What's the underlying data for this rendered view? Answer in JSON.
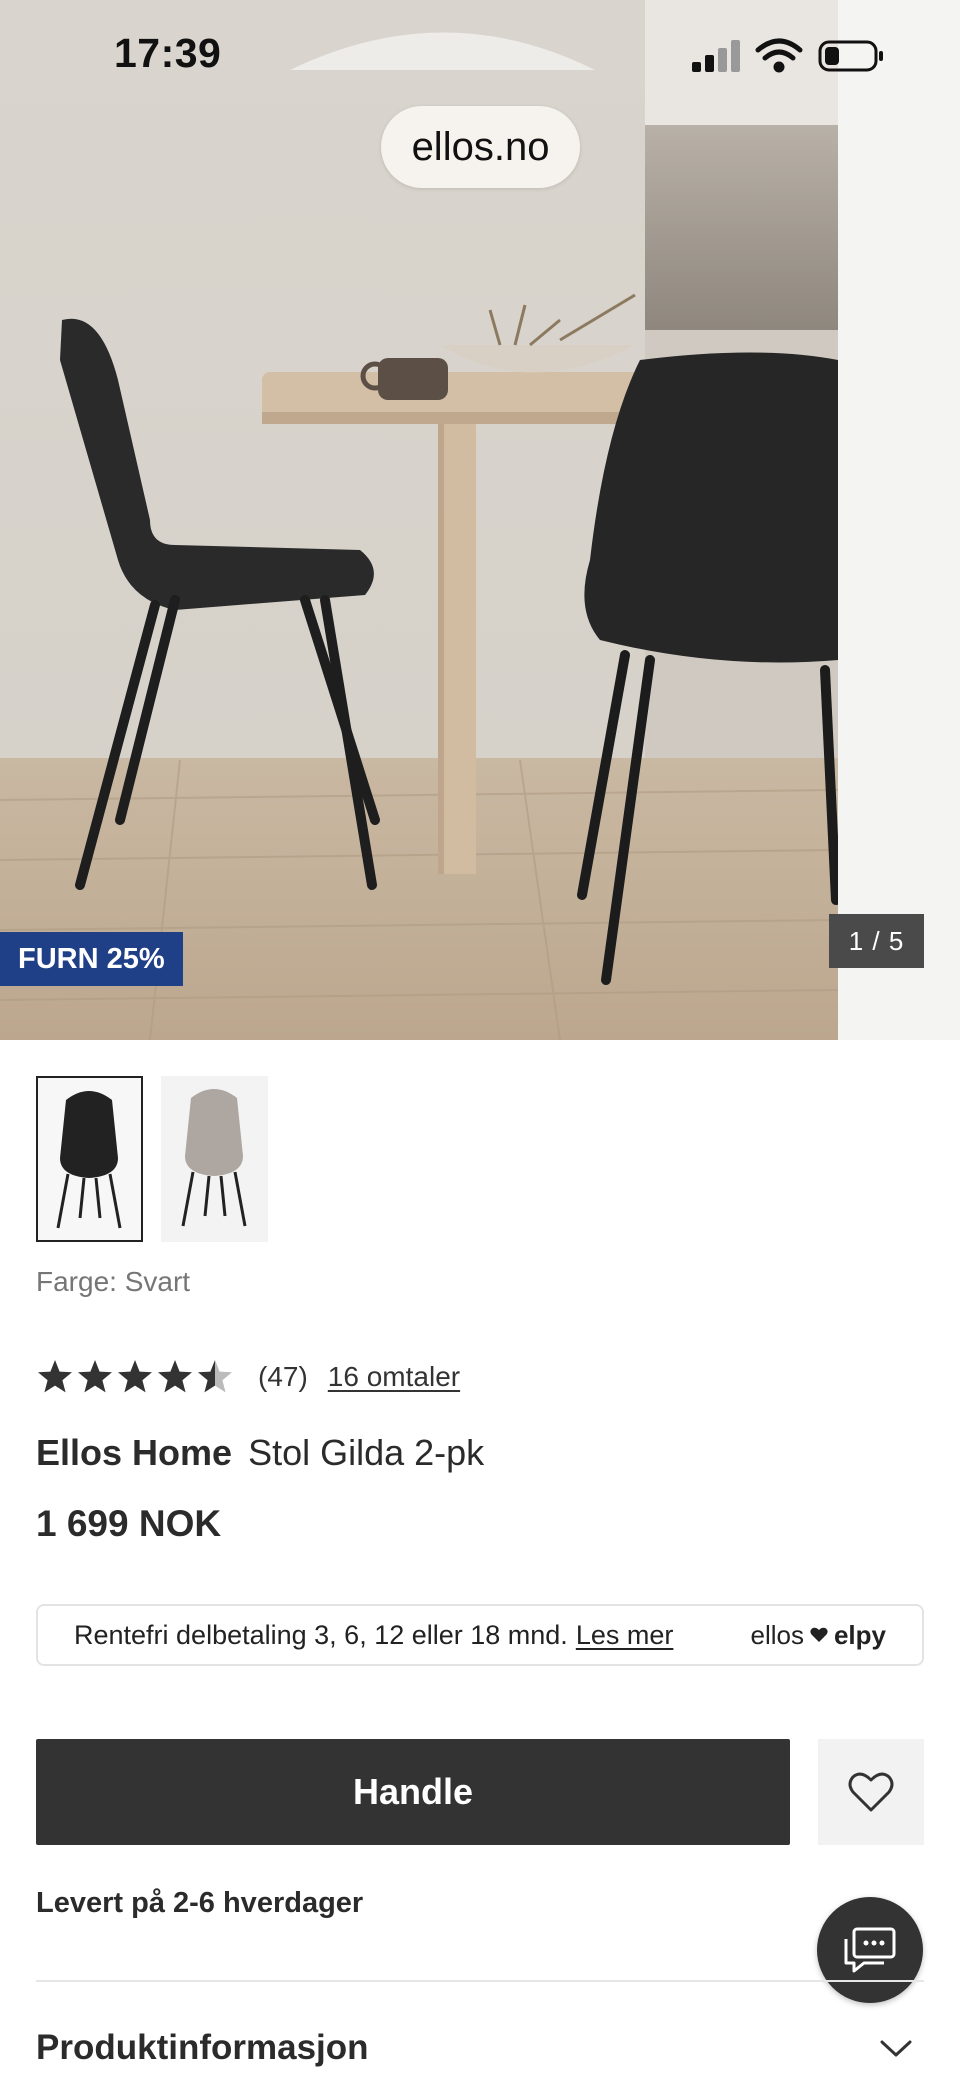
{
  "status_bar": {
    "time": "17:39"
  },
  "browser": {
    "url": "ellos.no"
  },
  "gallery": {
    "promo_badge": "FURN 25%",
    "counter": "1 / 5"
  },
  "product": {
    "color_label": "Farge: Svart",
    "rating": {
      "score": 4.5,
      "max": 5,
      "count": "(47)",
      "reviews_link": "16 omtaler"
    },
    "brand": "Ellos Home",
    "name": "Stol Gilda 2-pk",
    "price": "1 699 NOK"
  },
  "financing": {
    "text": "Rentefri delbetaling 3, 6, 12 eller 18 mnd.",
    "link": "Les mer",
    "logo_left": "ellos",
    "logo_right": "elpy"
  },
  "actions": {
    "buy_label": "Handle",
    "favorite_icon": "heart-icon",
    "chat_icon": "chat-icon"
  },
  "delivery": "Levert på 2-6 hverdager",
  "sections": [
    {
      "title": "Produktinformasjon"
    }
  ],
  "colors": {
    "promo": "#1f3f86",
    "button": "#333333"
  }
}
